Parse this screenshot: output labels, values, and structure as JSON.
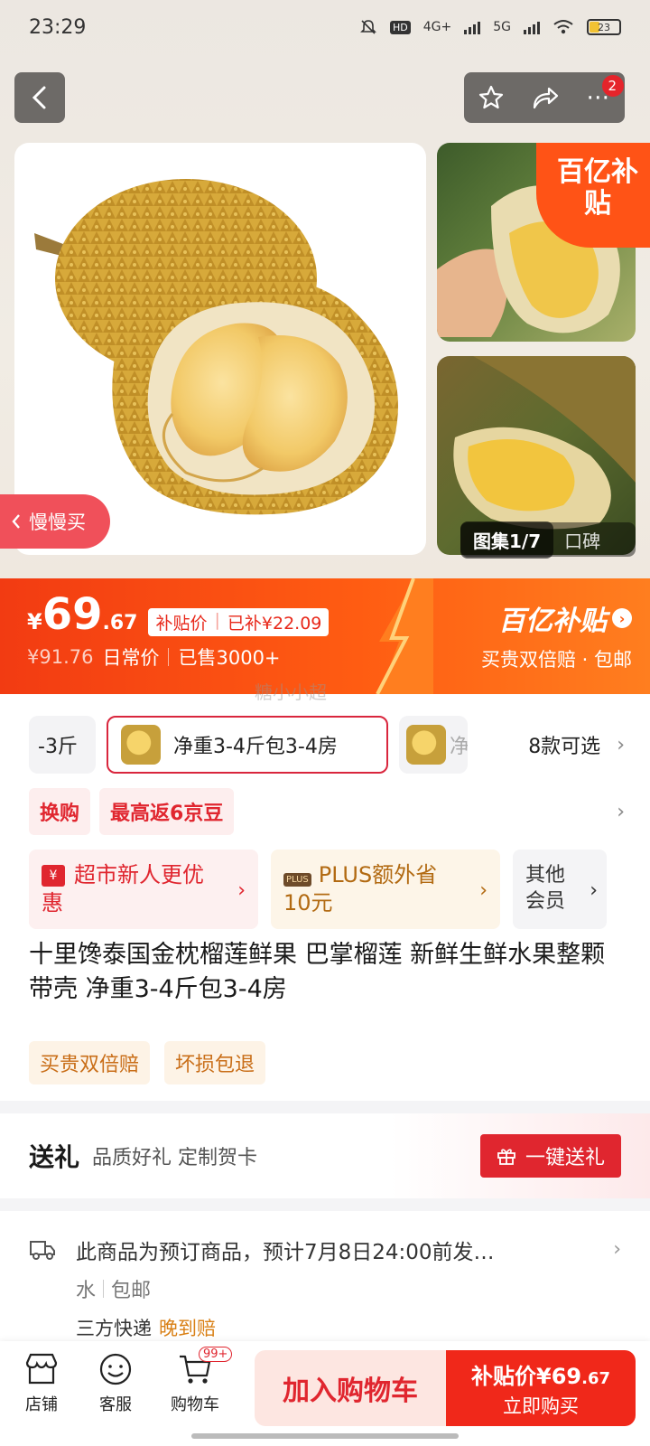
{
  "status_bar": {
    "time": "23:29",
    "hd": "HD",
    "net1": "4G+",
    "net2": "5G",
    "battery": "23"
  },
  "top_actions": {
    "badge": "2"
  },
  "gallery": {
    "corner_brand": "百亿补贴",
    "label": "图集1/7",
    "reviews": "口碑"
  },
  "slow_buy": "慢慢买",
  "price": {
    "currency": "¥",
    "integer": "69",
    "decimal": ".67",
    "tag_label": "补贴价",
    "tag_extra": "已补¥22.09",
    "original": "¥91.76",
    "original_label": "日常价",
    "sold": "已售3000+",
    "brand": "百亿补贴",
    "brand_sub": "买贵双倍赔 · 包邮"
  },
  "watermark": "糖小小超",
  "variants": {
    "items": [
      {
        "label": "-3斤"
      },
      {
        "label": "净重3-4斤包3-4房"
      },
      {
        "label": "净"
      }
    ],
    "count": "8款可选"
  },
  "promos": [
    "换购",
    "最高返6京豆"
  ],
  "benefits": {
    "b1": "超市新人更优惠",
    "b2_badge": "PLUS",
    "b2": "PLUS额外省10元",
    "b3": "其他会员"
  },
  "product": {
    "title": "十里馋泰国金枕榴莲鲜果 巴掌榴莲 新鲜生鲜水果整颗带壳 净重3-4斤包3-4房",
    "tags": [
      "买贵双倍赔",
      "坏损包退"
    ]
  },
  "gift": {
    "title": "送礼",
    "subtitle": "品质好礼 定制贺卡",
    "button": "一键送礼"
  },
  "delivery": {
    "line1": "此商品为预订商品，预计7月8日24:00前发…",
    "line2a": "水",
    "line2b": "包邮",
    "line3": "三方快递",
    "line3_tag": "晚到赔"
  },
  "bottom_bar": {
    "store": "店铺",
    "service": "客服",
    "cart": "购物车",
    "cart_badge": "99+",
    "add_cart": "加入购物车",
    "buy_label": "补贴价¥69",
    "buy_decimal": ".67",
    "buy_now": "立即购买"
  }
}
